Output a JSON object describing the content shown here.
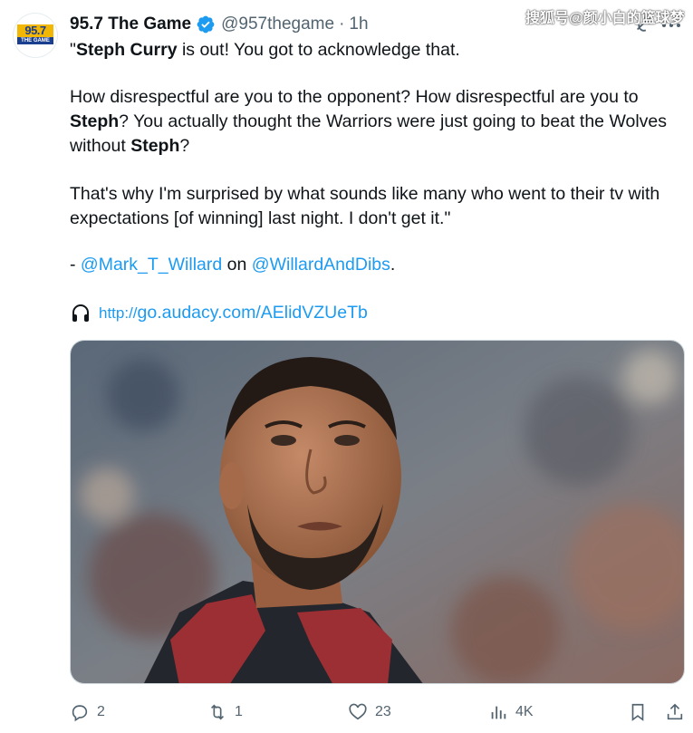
{
  "account": {
    "display_name": "95.7 The Game",
    "handle": "@957thegame",
    "separator": "·",
    "time": "1h",
    "avatar_text_top": "95.7",
    "avatar_text_bottom": "THE GAME"
  },
  "watermark": "搜狐号@颜小白的篮球梦",
  "tweet": {
    "p1": {
      "t1": "\"",
      "b1": "Steph Curry",
      "t2": " is out! You got to acknowledge that."
    },
    "p2": {
      "t1": "How disrespectful are you to the opponent? How disrespectful are you to ",
      "b1": "Steph",
      "t2": "? You actually thought the Warriors were just going to beat the Wolves without ",
      "b2": "Steph",
      "t3": "?"
    },
    "p3": "That's why I'm surprised by what sounds like many who went to their tv with expectations [of winning] last night. I don't get it.\"",
    "p4": {
      "t1": "- ",
      "m1": "@Mark_T_Willard",
      "t2": " on ",
      "m2": "@WillardAndDibs",
      "t3": "."
    },
    "link": {
      "prefix": "http://",
      "main": "go.audacy.com/AElidVZUeTb"
    }
  },
  "actions": {
    "replies": "2",
    "reposts": "1",
    "likes": "23",
    "views": "4K"
  },
  "icons": {
    "verified": "verified-badge-icon",
    "grok": "grok-icon",
    "more": "more-icon",
    "headphones": "headphones-icon",
    "reply": "reply-icon",
    "repost": "repost-icon",
    "like": "heart-icon",
    "views": "views-icon",
    "bookmark": "bookmark-icon",
    "share": "share-icon"
  },
  "colors": {
    "link": "#1d9bf0",
    "muted": "#536471",
    "text": "#0f1419",
    "verified": "#1d9bf0"
  }
}
